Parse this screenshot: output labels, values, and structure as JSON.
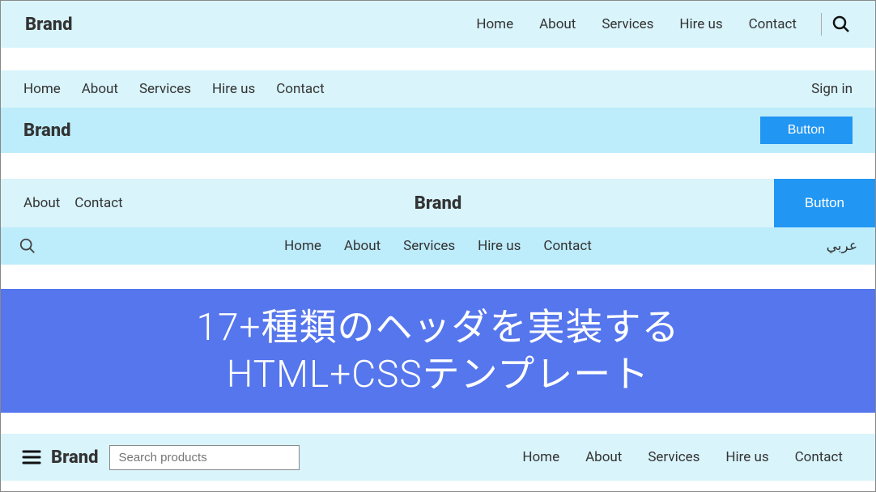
{
  "brand": "Brand",
  "nav": {
    "home": "Home",
    "about": "About",
    "services": "Services",
    "hireus": "Hire us",
    "contact": "Contact"
  },
  "header2": {
    "signin": "Sign in",
    "button": "Button"
  },
  "header3": {
    "about": "About",
    "contact": "Contact",
    "button": "Button",
    "arabic": "عربي"
  },
  "hero": {
    "line1": "17+種類のヘッダを実装する",
    "line2": "HTML+CSSテンプレート"
  },
  "header4": {
    "search_placeholder": "Search products"
  }
}
